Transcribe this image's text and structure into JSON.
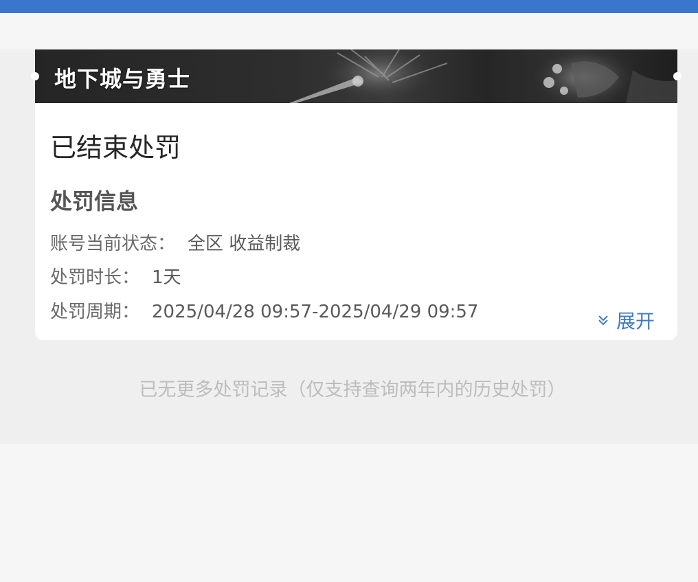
{
  "banner": {
    "title": "地下城与勇士"
  },
  "card": {
    "status": "已结束处罚",
    "section_title": "处罚信息",
    "rows": [
      {
        "label": "账号当前状态：",
        "value": "全区 收益制裁"
      },
      {
        "label": "处罚时长：",
        "value": "1天"
      },
      {
        "label": "处罚周期：",
        "value": "2025/04/28 09:57-2025/04/29 09:57"
      }
    ],
    "expand_label": "展开",
    "expand_icon": "double-chevron-down-icon"
  },
  "footer": {
    "note": "已无更多处罚记录（仅支持查询两年内的历史处罚）"
  },
  "colors": {
    "top_bar": "#3a77cc",
    "accent_link": "#3f79c6",
    "card_bg": "#ffffff",
    "page_bg": "#efefef"
  }
}
